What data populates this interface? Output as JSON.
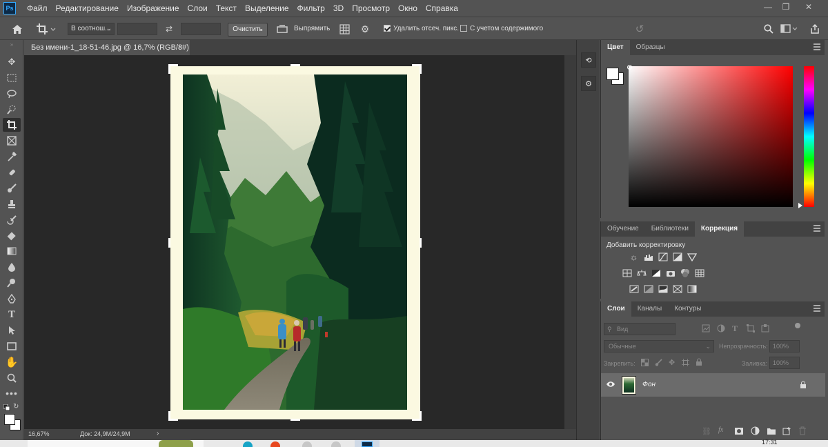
{
  "app": {
    "logo": "Ps"
  },
  "menu": [
    "Файл",
    "Редактирование",
    "Изображение",
    "Слои",
    "Текст",
    "Выделение",
    "Фильтр",
    "3D",
    "Просмотр",
    "Окно",
    "Справка"
  ],
  "window_controls": {
    "minimize": "—",
    "restore": "❐",
    "close": "✕"
  },
  "options": {
    "ratio_label": "В соотнош...",
    "width_value": "",
    "height_value": "",
    "clear_label": "Очистить",
    "straighten_label": "Выпрямить",
    "delete_cropped": {
      "label": "Удалить отсеч. пикс.",
      "checked": true
    },
    "content_aware": {
      "label": "С учетом содержимого",
      "checked": false
    }
  },
  "document": {
    "tab_title": "Без имени-1_18-51-46.jpg @ 16,7% (RGB/8#)",
    "tab_close": "×",
    "zoom": "16,67%",
    "doc_size": "Док: 24,9M/24,9M",
    "frame_color": "#fbf9e1"
  },
  "color_panel": {
    "tabs": [
      "Цвет",
      "Образцы"
    ],
    "active_tab": "Цвет",
    "foreground": "#ffffff",
    "background": "#ffffff",
    "hue_color": "#ff0000"
  },
  "adjust_panel": {
    "tabs": [
      "Обучение",
      "Библиотеки",
      "Коррекция"
    ],
    "active_tab": "Коррекция",
    "title": "Добавить корректировку",
    "icon_rows": [
      [
        "brightness-icon",
        "levels-icon",
        "curves-icon",
        "exposure-icon",
        "vibrance-icon"
      ],
      [
        "hue-saturation-icon",
        "color-balance-icon",
        "black-white-icon",
        "photo-filter-icon",
        "channel-mixer-icon",
        "color-lookup-icon"
      ],
      [
        "invert-icon",
        "posterize-icon",
        "threshold-icon",
        "selective-color-icon",
        "gradient-map-icon"
      ]
    ]
  },
  "layers_panel": {
    "tabs": [
      "Слои",
      "Каналы",
      "Контуры"
    ],
    "active_tab": "Слои",
    "search_placeholder": "Вид",
    "blend_mode": "Обычные",
    "opacity_label": "Непрозрачность:",
    "opacity_value": "100%",
    "lock_label": "Закрепить:",
    "fill_label": "Заливка:",
    "fill_value": "100%",
    "layers": [
      {
        "name": "Фон",
        "visible": true,
        "locked": true
      }
    ]
  },
  "taskbar": {
    "clock": "17:31"
  }
}
